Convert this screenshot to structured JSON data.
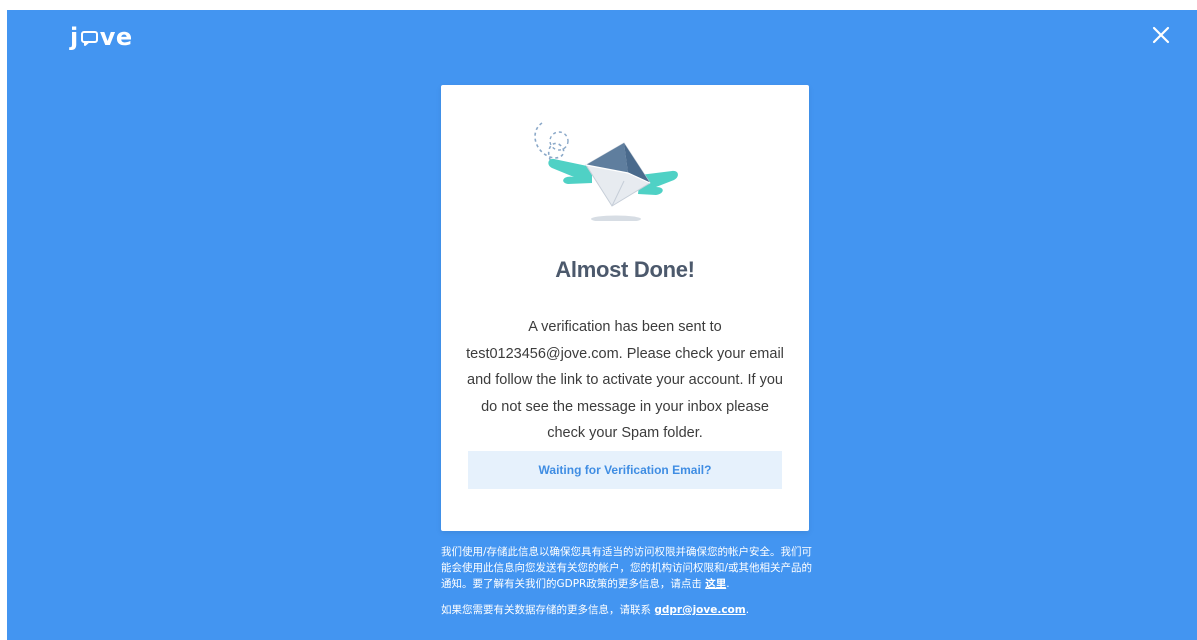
{
  "header": {
    "logo_left": "j",
    "logo_right": "ve",
    "close_icon": "close-icon"
  },
  "colors": {
    "background": "#4395f1",
    "title": "#4c596c",
    "link_button_bg": "#e6f1fc",
    "link_button_text": "#3f8de3"
  },
  "card": {
    "illustration_icon": "flying-envelope-icon",
    "title": "Almost Done!",
    "message": "A verification has been sent to test0123456@jove.com. Please check your email and follow the link to activate your account. If you do not see the message in your inbox please check your Spam folder.",
    "waiting_button": "Waiting for Verification Email?"
  },
  "notice": {
    "text": "我们使用/存储此信息以确保您具有适当的访问权限并确保您的帐户安全。我们可能会使用此信息向您发送有关您的帐户，您的机构访问权限和/或其他相关产品的通知。要了解有关我们的GDPR政策的更多信息，请点击",
    "link": "这里",
    "end": ".",
    "contact_text": "如果您需要有关数据存储的更多信息，请联系",
    "contact_link": "gdpr@jove.com",
    "contact_end": "."
  }
}
